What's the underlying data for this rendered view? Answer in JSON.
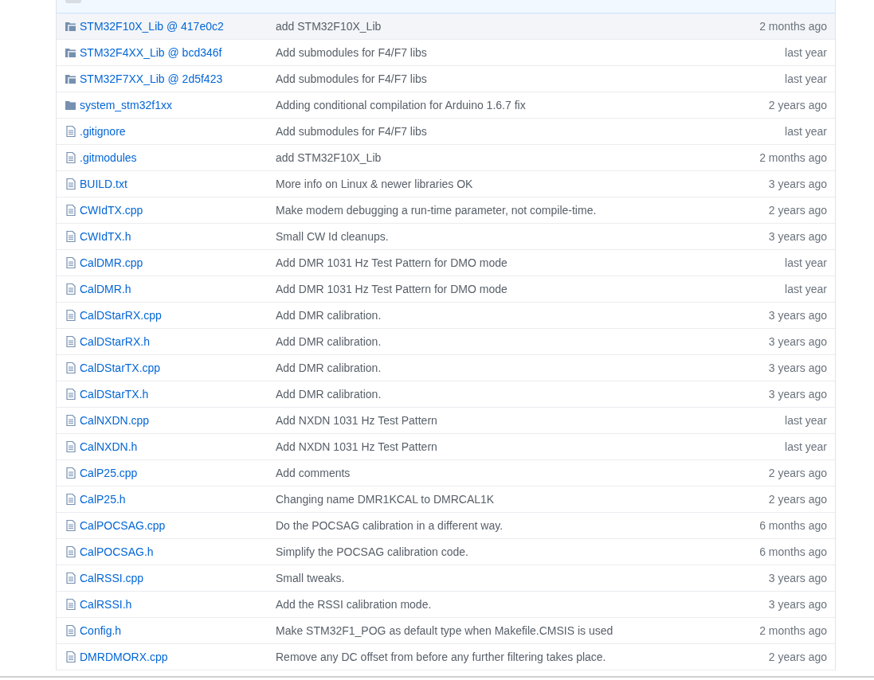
{
  "files": [
    {
      "kind": "submodule",
      "name": "STM32F10X_Lib @ 417e0c2",
      "message": "add STM32F10X_Lib",
      "age": "2 months ago",
      "selected": true
    },
    {
      "kind": "submodule",
      "name": "STM32F4XX_Lib @ bcd346f",
      "message": "Add submodules for F4/F7 libs",
      "age": "last year",
      "selected": false
    },
    {
      "kind": "submodule",
      "name": "STM32F7XX_Lib @ 2d5f423",
      "message": "Add submodules for F4/F7 libs",
      "age": "last year",
      "selected": false
    },
    {
      "kind": "folder",
      "name": "system_stm32f1xx",
      "message": "Adding conditional compilation for Arduino 1.6.7 fix",
      "age": "2 years ago",
      "selected": false
    },
    {
      "kind": "file",
      "name": ".gitignore",
      "message": "Add submodules for F4/F7 libs",
      "age": "last year",
      "selected": false
    },
    {
      "kind": "file",
      "name": ".gitmodules",
      "message": "add STM32F10X_Lib",
      "age": "2 months ago",
      "selected": false
    },
    {
      "kind": "file",
      "name": "BUILD.txt",
      "message": "More info on Linux & newer libraries OK",
      "age": "3 years ago",
      "selected": false
    },
    {
      "kind": "file",
      "name": "CWIdTX.cpp",
      "message": "Make modem debugging a run-time parameter, not compile-time.",
      "age": "2 years ago",
      "selected": false
    },
    {
      "kind": "file",
      "name": "CWIdTX.h",
      "message": "Small CW Id cleanups.",
      "age": "3 years ago",
      "selected": false
    },
    {
      "kind": "file",
      "name": "CalDMR.cpp",
      "message": "Add DMR 1031 Hz Test Pattern for DMO mode",
      "age": "last year",
      "selected": false
    },
    {
      "kind": "file",
      "name": "CalDMR.h",
      "message": "Add DMR 1031 Hz Test Pattern for DMO mode",
      "age": "last year",
      "selected": false
    },
    {
      "kind": "file",
      "name": "CalDStarRX.cpp",
      "message": "Add DMR calibration.",
      "age": "3 years ago",
      "selected": false
    },
    {
      "kind": "file",
      "name": "CalDStarRX.h",
      "message": "Add DMR calibration.",
      "age": "3 years ago",
      "selected": false
    },
    {
      "kind": "file",
      "name": "CalDStarTX.cpp",
      "message": "Add DMR calibration.",
      "age": "3 years ago",
      "selected": false
    },
    {
      "kind": "file",
      "name": "CalDStarTX.h",
      "message": "Add DMR calibration.",
      "age": "3 years ago",
      "selected": false
    },
    {
      "kind": "file",
      "name": "CalNXDN.cpp",
      "message": "Add NXDN 1031 Hz Test Pattern",
      "age": "last year",
      "selected": false
    },
    {
      "kind": "file",
      "name": "CalNXDN.h",
      "message": "Add NXDN 1031 Hz Test Pattern",
      "age": "last year",
      "selected": false
    },
    {
      "kind": "file",
      "name": "CalP25.cpp",
      "message": "Add comments",
      "age": "2 years ago",
      "selected": false
    },
    {
      "kind": "file",
      "name": "CalP25.h",
      "message": "Changing name DMR1KCAL to DMRCAL1K",
      "age": "2 years ago",
      "selected": false
    },
    {
      "kind": "file",
      "name": "CalPOCSAG.cpp",
      "message": "Do the POCSAG calibration in a different way.",
      "age": "6 months ago",
      "selected": false
    },
    {
      "kind": "file",
      "name": "CalPOCSAG.h",
      "message": "Simplify the POCSAG calibration code.",
      "age": "6 months ago",
      "selected": false
    },
    {
      "kind": "file",
      "name": "CalRSSI.cpp",
      "message": "Small tweaks.",
      "age": "3 years ago",
      "selected": false
    },
    {
      "kind": "file",
      "name": "CalRSSI.h",
      "message": "Add the RSSI calibration mode.",
      "age": "3 years ago",
      "selected": false
    },
    {
      "kind": "file",
      "name": "Config.h",
      "message": "Make STM32F1_POG as default type when Makefile.CMSIS is used",
      "age": "2 months ago",
      "selected": false
    },
    {
      "kind": "file",
      "name": "DMRDMORX.cpp",
      "message": "Remove any DC offset from before any further filtering takes place.",
      "age": "2 years ago",
      "selected": false
    }
  ]
}
